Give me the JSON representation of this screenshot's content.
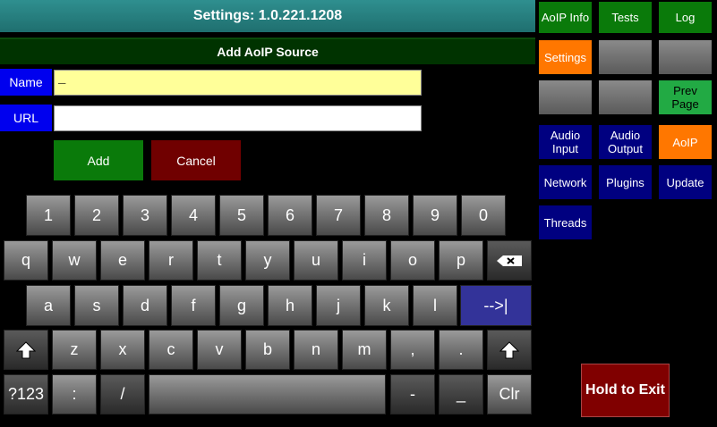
{
  "header": {
    "title": "Settings: 1.0.221.1208",
    "subtitle": "Add AoIP Source"
  },
  "form": {
    "name_label": "Name",
    "name_value": "_",
    "url_label": "URL",
    "url_value": "",
    "add_label": "Add",
    "cancel_label": "Cancel"
  },
  "keyboard": {
    "digits": [
      "1",
      "2",
      "3",
      "4",
      "5",
      "6",
      "7",
      "8",
      "9",
      "0"
    ],
    "row1": [
      "q",
      "w",
      "e",
      "r",
      "t",
      "y",
      "u",
      "i",
      "o",
      "p"
    ],
    "row2": [
      "a",
      "s",
      "d",
      "f",
      "g",
      "h",
      "j",
      "k",
      "l"
    ],
    "tab_label": "-->|",
    "row3": [
      "z",
      "x",
      "c",
      "v",
      "b",
      "n",
      "m",
      ",",
      "."
    ],
    "mode_label": "?123",
    "colon": ":",
    "slash": "/",
    "dash": "-",
    "underscore": "_",
    "clear_label": "Clr"
  },
  "nav": {
    "aoip_info": "AoIP Info",
    "tests": "Tests",
    "log": "Log",
    "settings": "Settings",
    "prev_page": "Prev Page",
    "audio_input": "Audio\nInput",
    "audio_output": "Audio\nOutput",
    "aoip": "AoIP",
    "network": "Network",
    "plugins": "Plugins",
    "update": "Update",
    "threads": "Threads"
  },
  "exit_label": "Hold to Exit"
}
